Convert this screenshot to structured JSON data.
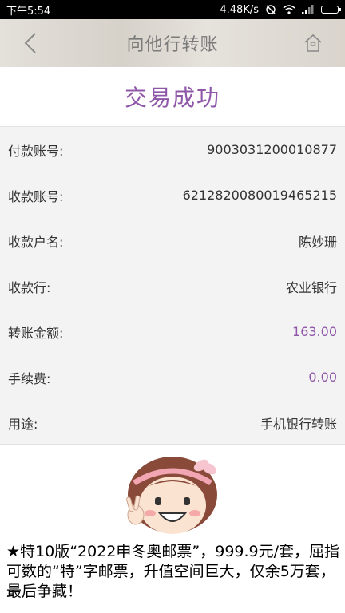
{
  "status_bar": {
    "time": "下午5:54",
    "network_speed": "4.48K/s"
  },
  "nav": {
    "title": "向他行转账",
    "back_icon": "chevron-left-icon",
    "home_icon": "home-icon"
  },
  "result": {
    "status_text": "交易成功"
  },
  "details": [
    {
      "label": "付款账号:",
      "value": "9003031200010877",
      "accent": false
    },
    {
      "label": "收款账号:",
      "value": "6212820080019465215",
      "accent": false
    },
    {
      "label": "收款户名:",
      "value": "陈妙珊",
      "accent": false
    },
    {
      "label": "收款行:",
      "value": "农业银行",
      "accent": false
    },
    {
      "label": "转账金额:",
      "value": "163.00",
      "accent": true
    },
    {
      "label": "手续费:",
      "value": "0.00",
      "accent": true
    },
    {
      "label": "用途:",
      "value": "手机银行转账",
      "accent": false
    }
  ],
  "banner": {
    "ad_text": "★特10版“2022申冬奥邮票”，999.9元/套，屈指可数的“特”字邮票，升值空间巨大，仅余5万套，最后争藏！",
    "mascot_icon": "girl-mascot-icon"
  },
  "colors": {
    "accent": "#8e57a8",
    "nav_bg": "#dcd8d1",
    "detail_bg": "#f4f3f3"
  }
}
